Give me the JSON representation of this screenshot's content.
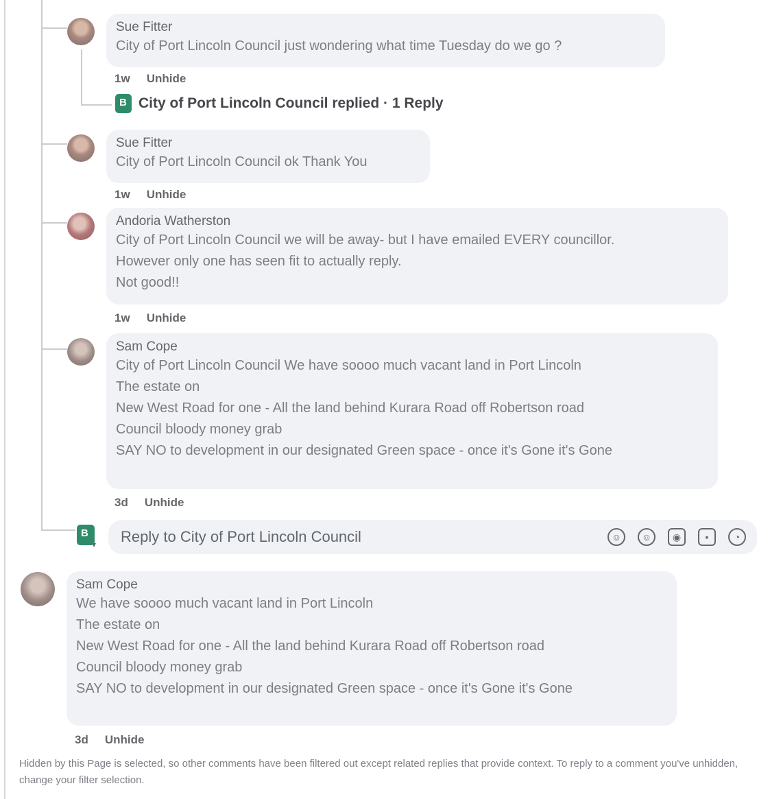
{
  "comments": [
    {
      "author": "Sue Fitter",
      "lines": [
        "City of Port Lincoln Council just wondering what time Tuesday do we go ?"
      ],
      "time": "1w",
      "action": "Unhide"
    },
    {
      "author": "Sue Fitter",
      "lines": [
        "City of Port Lincoln Council ok Thank You"
      ],
      "time": "1w",
      "action": "Unhide"
    },
    {
      "author": "Andoria Watherston",
      "lines": [
        "City of Port Lincoln Council we will be away- but I have emailed EVERY councillor.",
        "However only one has seen fit to actually reply.",
        "Not good!!"
      ],
      "time": "1w",
      "action": "Unhide"
    },
    {
      "author": "Sam Cope",
      "lines": [
        "City of Port Lincoln Council We have soooo much vacant land in Port Lincoln",
        "The estate on",
        "New West Road for one - All the land behind Kurara Road off Robertson road",
        "Council bloody money grab",
        "SAY NO to development in our designated Green space - once it's Gone it's Gone"
      ],
      "time": "3d",
      "action": "Unhide"
    }
  ],
  "replied_summary": "City of Port Lincoln Council replied · 1 Reply",
  "reply_box": {
    "placeholder": "Reply to City of Port Lincoln Council"
  },
  "top_comment": {
    "author": "Sam Cope",
    "lines": [
      "We have soooo much vacant land in Port Lincoln",
      "The estate on",
      "New West Road for one - All the land behind Kurara Road off Robertson road",
      "Council bloody money grab",
      "SAY NO to development in our designated Green space - once it's Gone it's Gone"
    ],
    "time": "3d",
    "action": "Unhide"
  },
  "footer_note": "Hidden by this Page is selected, so other comments have been filtered out except related replies that provide context. To reply to a comment you've unhidden, change your filter selection.",
  "icons": [
    "avatar-emoji-icon",
    "emoji-icon",
    "camera-icon",
    "gif-icon",
    "sticker-icon"
  ]
}
